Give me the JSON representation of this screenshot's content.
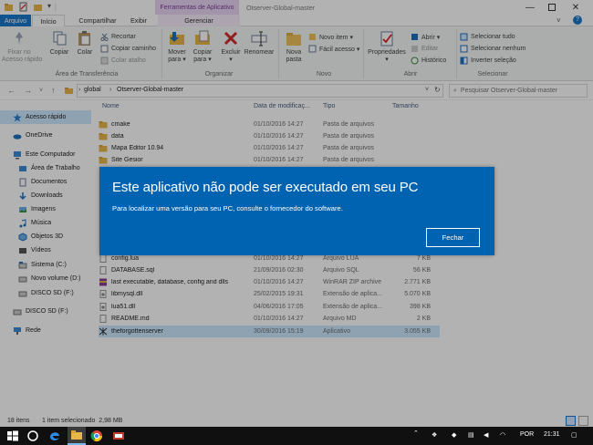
{
  "titlebar": {
    "context_tab": "Ferramentas de Aplicativo",
    "window_title": "Otserver-Global-master"
  },
  "tabs": {
    "file": "Arquivo",
    "home": "Início",
    "share": "Compartilhar",
    "view": "Exibir",
    "manage": "Gerenciar"
  },
  "ribbon": {
    "pin": "Fixar no\nAcesso rápido",
    "copy": "Copiar",
    "paste": "Colar",
    "cut": "Recortar",
    "copy_path": "Copiar caminho",
    "paste_shortcut": "Colar atalho",
    "move_to": "Mover\npara ▾",
    "copy_to": "Copiar\npara ▾",
    "delete": "Excluir\n▾",
    "rename": "Renomear",
    "new_folder": "Nova\npasta",
    "new_item": "Novo item ▾",
    "easy_access": "Fácil acesso ▾",
    "properties": "Propriedades\n▾",
    "open": "Abrir ▾",
    "edit": "Editar",
    "history": "Histórico",
    "select_all": "Selecionar tudo",
    "select_none": "Selecionar nenhum",
    "invert": "Inverter seleção",
    "groups": {
      "clipboard": "Área de Transferência",
      "organize": "Organizar",
      "new": "Novo",
      "open": "Abrir",
      "select": "Selecionar"
    }
  },
  "address": {
    "crumb1": "global",
    "crumb2": "Otserver-Global-master",
    "search_placeholder": "Pesquisar Otserver-Global-master"
  },
  "nav": {
    "items": [
      "Acesso rápido",
      "OneDrive",
      "Este Computador",
      "Área de Trabalho",
      "Documentos",
      "Downloads",
      "Imagens",
      "Música",
      "Objetos 3D",
      "Vídeos",
      "Sistema (C:)",
      "Novo volume (D:)",
      "DISCO SD (F:)",
      "DISCO SD (F:)",
      "Rede"
    ]
  },
  "columns": {
    "name": "Nome",
    "date": "Data de modificaç...",
    "type": "Tipo",
    "size": "Tamanho"
  },
  "files_top": [
    {
      "name": "cmake",
      "date": "01/10/2016 14:27",
      "type": "Pasta de arquivos",
      "size": ""
    },
    {
      "name": "data",
      "date": "01/10/2016 14:27",
      "type": "Pasta de arquivos",
      "size": ""
    },
    {
      "name": "Mapa Editor 10.94",
      "date": "01/10/2016 14:27",
      "type": "Pasta de arquivos",
      "size": ""
    },
    {
      "name": "Site Gesior",
      "date": "01/10/2016 14:27",
      "type": "Pasta de arquivos",
      "size": ""
    }
  ],
  "files_bottom": [
    {
      "name": "config.lua",
      "date": "01/10/2016 14:27",
      "type": "Arquivo LUA",
      "size": "7 KB"
    },
    {
      "name": "DATABASE.sql",
      "date": "21/09/2016 02:30",
      "type": "Arquivo SQL",
      "size": "56 KB"
    },
    {
      "name": "last executable, database, config and dlls",
      "date": "01/10/2016 14:27",
      "type": "WinRAR ZIP archive",
      "size": "2.771 KB"
    },
    {
      "name": "libmysql.dll",
      "date": "25/02/2015 19:31",
      "type": "Extensão de aplica...",
      "size": "5.070 KB"
    },
    {
      "name": "lua51.dll",
      "date": "04/06/2016 17:05",
      "type": "Extensão de aplica...",
      "size": "398 KB"
    },
    {
      "name": "README.md",
      "date": "01/10/2016 14:27",
      "type": "Arquivo MD",
      "size": "2 KB"
    },
    {
      "name": "theforgottenserver",
      "date": "30/09/2016 15:19",
      "type": "Aplicativo",
      "size": "3.055 KB"
    }
  ],
  "status": {
    "count": "18 itens",
    "selected": "1 item selecionado  2,98 MB"
  },
  "taskbar": {
    "lang": "POR",
    "time": "21:31"
  },
  "dialog": {
    "title": "Este aplicativo não pode ser executado em seu PC",
    "message": "Para localizar uma versão para seu PC, consulte o fornecedor do software.",
    "close": "Fechar"
  },
  "colors": {
    "dialog_bg": "#0063b1",
    "file_tab": "#1979ca",
    "context_tab": "#e8d6f3",
    "selected_row": "#cce8ff"
  }
}
